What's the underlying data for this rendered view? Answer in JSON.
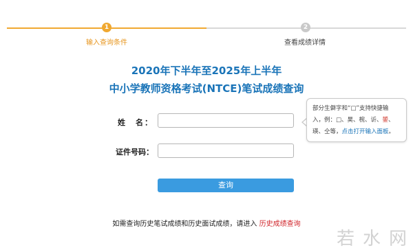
{
  "steps": [
    {
      "number": "1",
      "label": "输入查询条件"
    },
    {
      "number": "2",
      "label": "查看成绩详情"
    }
  ],
  "title": {
    "line1": "2020年下半年至2025年上半年",
    "line2": "中小学教师资格考试(NTCE)笔试成绩查询"
  },
  "form": {
    "name_label": "姓　名：",
    "id_label": "证件号码：",
    "name_value": "",
    "id_value": "",
    "query_button": "查询"
  },
  "tooltip": {
    "line1": "部分生僻字和“□”支持快捷输",
    "line2_a": "入，例：□、昊、椀、䜣、",
    "line2_hl": "𨭉",
    "line2_b": "、",
    "line3_a": "瑛、仝等，",
    "line3_link": "点击打开输入面板",
    "line3_b": "。"
  },
  "footer": {
    "text": "如需查询历史笔试成绩和历史面试成绩，请进入",
    "link": "历史成绩查询"
  },
  "watermark": "若水网",
  "colors": {
    "accent_orange": "#f0a830",
    "title_blue": "#1a74b8",
    "button_blue": "#3a9be0",
    "link_red": "#d0252b"
  }
}
